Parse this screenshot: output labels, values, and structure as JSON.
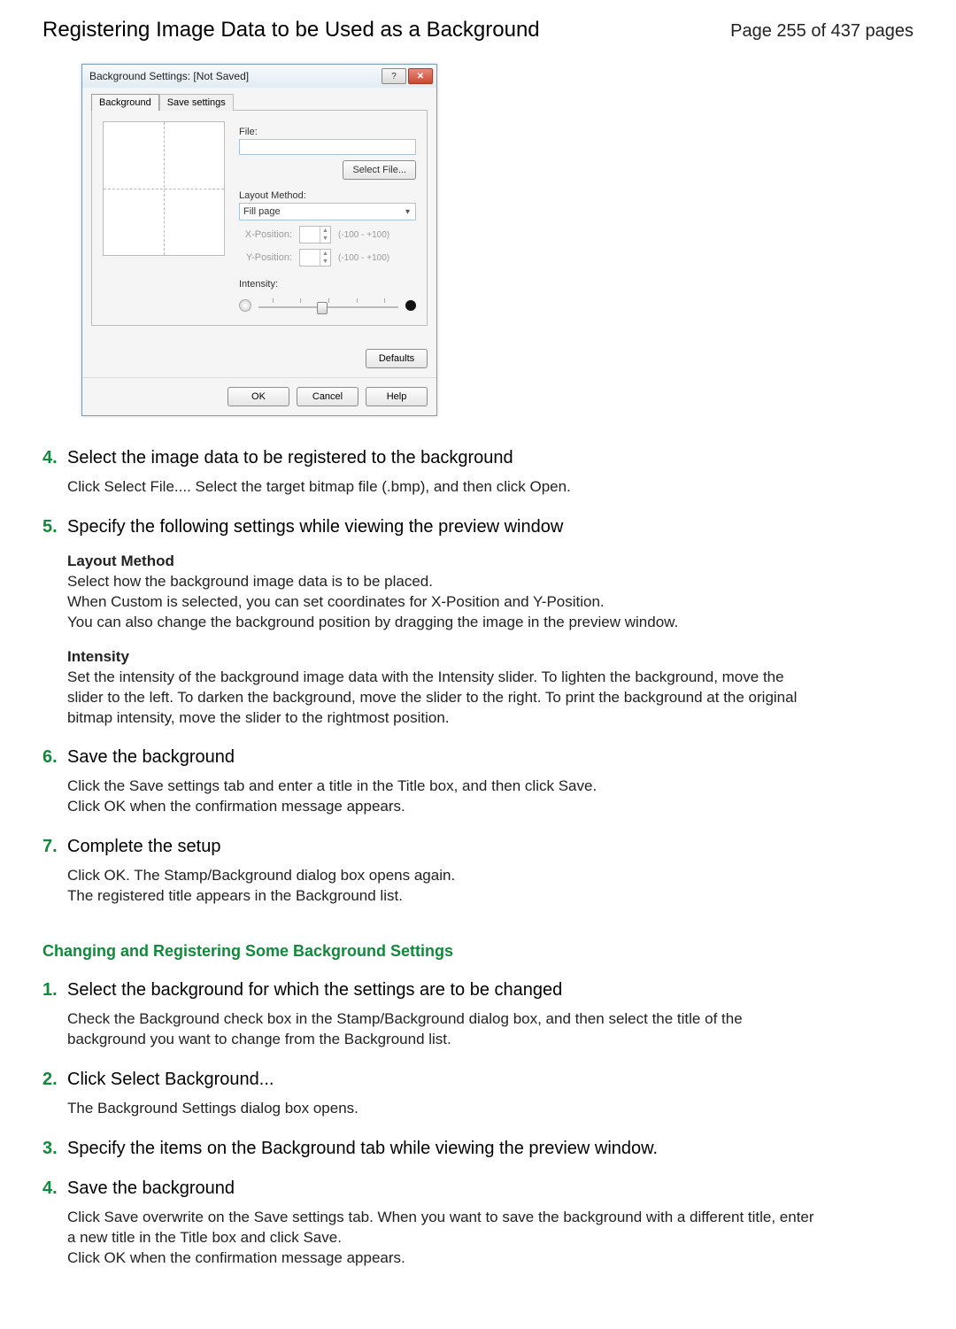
{
  "header": {
    "title": "Registering Image Data to be Used as a Background",
    "page_info": "Page 255 of 437 pages"
  },
  "dialog": {
    "title": "Background Settings: [Not Saved]",
    "tabs": [
      "Background",
      "Save settings"
    ],
    "file_label": "File:",
    "select_file_btn": "Select File...",
    "layout_label": "Layout Method:",
    "layout_value": "Fill page",
    "xpos_label": "X-Position:",
    "ypos_label": "Y-Position:",
    "range_hint": "(-100 - +100)",
    "intensity_label": "Intensity:",
    "defaults_btn": "Defaults",
    "ok_btn": "OK",
    "cancel_btn": "Cancel",
    "help_btn": "Help"
  },
  "steps_a": [
    {
      "num": "4.",
      "title": "Select the image data to be registered to the background",
      "body": "Click Select File.... Select the target bitmap file (.bmp), and then click Open."
    },
    {
      "num": "5.",
      "title": "Specify the following settings while viewing the preview window",
      "sub": [
        {
          "head": "Layout Method",
          "lines": [
            "Select how the background image data is to be placed.",
            "When Custom is selected, you can set coordinates for X-Position and Y-Position.",
            "You can also change the background position by dragging the image in the preview window."
          ]
        },
        {
          "head": "Intensity",
          "lines": [
            "Set the intensity of the background image data with the Intensity slider. To lighten the background, move the slider to the left. To darken the background, move the slider to the right. To print the background at the original bitmap intensity, move the slider to the rightmost position."
          ]
        }
      ]
    },
    {
      "num": "6.",
      "title": "Save the background",
      "body": "Click the Save settings tab and enter a title in the Title box, and then click Save.\nClick OK when the confirmation message appears."
    },
    {
      "num": "7.",
      "title": "Complete the setup",
      "body": "Click OK. The Stamp/Background dialog box opens again.\nThe registered title appears in the Background list."
    }
  ],
  "section_b_heading": "Changing and Registering Some Background Settings",
  "steps_b": [
    {
      "num": "1.",
      "title": "Select the background for which the settings are to be changed",
      "body": "Check the Background check box in the Stamp/Background dialog box, and then select the title of the background you want to change from the Background list."
    },
    {
      "num": "2.",
      "title": "Click Select Background...",
      "body": "The Background Settings dialog box opens."
    },
    {
      "num": "3.",
      "title": "Specify the items on the Background tab while viewing the preview window."
    },
    {
      "num": "4.",
      "title": "Save the background",
      "body": "Click Save overwrite on the Save settings tab. When you want to save the background with a different title, enter a new title in the Title box and click Save.\nClick OK when the confirmation message appears."
    }
  ]
}
